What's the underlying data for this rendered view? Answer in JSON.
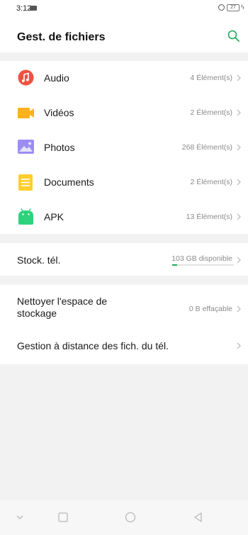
{
  "status": {
    "time": "3:12",
    "battery": "27"
  },
  "header": {
    "title": "Gest. de fichiers"
  },
  "categories": [
    {
      "label": "Audio",
      "count": "4 Élément(s)"
    },
    {
      "label": "Vidéos",
      "count": "2 Élément(s)"
    },
    {
      "label": "Photos",
      "count": "268 Élément(s)"
    },
    {
      "label": "Documents",
      "count": "2 Élément(s)"
    },
    {
      "label": "APK",
      "count": "13 Élément(s)"
    }
  ],
  "storage": {
    "label": "Stock. tél.",
    "available": "103 GB disponible",
    "used_fraction": 0.08
  },
  "cleanup": {
    "label_line1": "Nettoyer l'espace de",
    "label_line2": "stockage",
    "value": "0 B effaçable"
  },
  "remote": {
    "label": "Gestion à distance des fich. du tél."
  },
  "colors": {
    "accent": "#1da858",
    "audio": "#f0513f",
    "videos": "#ffb21a",
    "photos": "#9b8cf6",
    "documents": "#ffce2e",
    "apk": "#2fd27c"
  },
  "icons": [
    "search-icon",
    "music-note-icon",
    "video-camera-icon",
    "image-icon",
    "document-icon",
    "android-icon",
    "chevron-right-icon",
    "back-chevron-icon",
    "home-icon",
    "recents-icon"
  ]
}
